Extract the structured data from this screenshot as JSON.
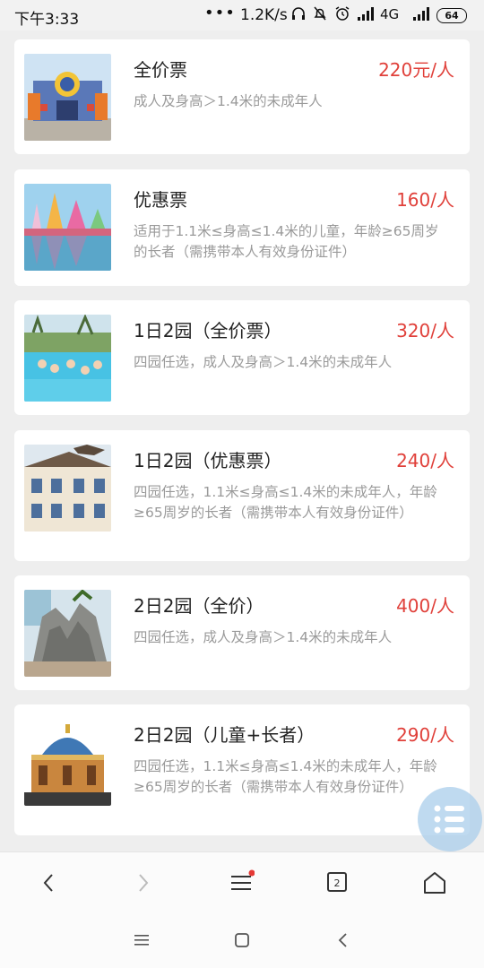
{
  "status_bar": {
    "time": "下午3:33",
    "dots": "•••",
    "speed": "1.2K/s",
    "network": "4G",
    "battery": "64"
  },
  "tickets": [
    {
      "name": "全价票",
      "price": "220元/人",
      "desc": "成人及身高＞1.4米的未成年人",
      "image": "theme-park-entrance"
    },
    {
      "name": "优惠票",
      "price": "160/人",
      "desc": "适用于1.1米≤身高≤1.4米的儿童，年龄≥65周岁的长者（需携带本人有效身份证件）",
      "image": "colorful-castle-reflection"
    },
    {
      "name": "1日2园（全价票）",
      "price": "320/人",
      "desc": "四园任选，成人及身高＞1.4米的未成年人",
      "image": "water-park-pool"
    },
    {
      "name": "1日2园（优惠票）",
      "price": "240/人",
      "desc": "四园任选，1.1米≤身高≤1.4米的未成年人，年龄≥65周岁的长者（需携带本人有效身份证件）",
      "image": "dinosaur-on-building"
    },
    {
      "name": "2日2园（全价）",
      "price": "400/人",
      "desc": "四园任选，成人及身高＞1.4米的未成年人",
      "image": "rock-mountain"
    },
    {
      "name": "2日2园（儿童+长者）",
      "price": "290/人",
      "desc": "四园任选，1.1米≤身高≤1.4米的未成年人，年龄≥65周岁的长者（需携带本人有效身份证件）",
      "image": "domed-palace"
    }
  ],
  "colors": {
    "price": "#e0403a",
    "desc": "#9a9a9a",
    "background": "#eeeeee"
  }
}
